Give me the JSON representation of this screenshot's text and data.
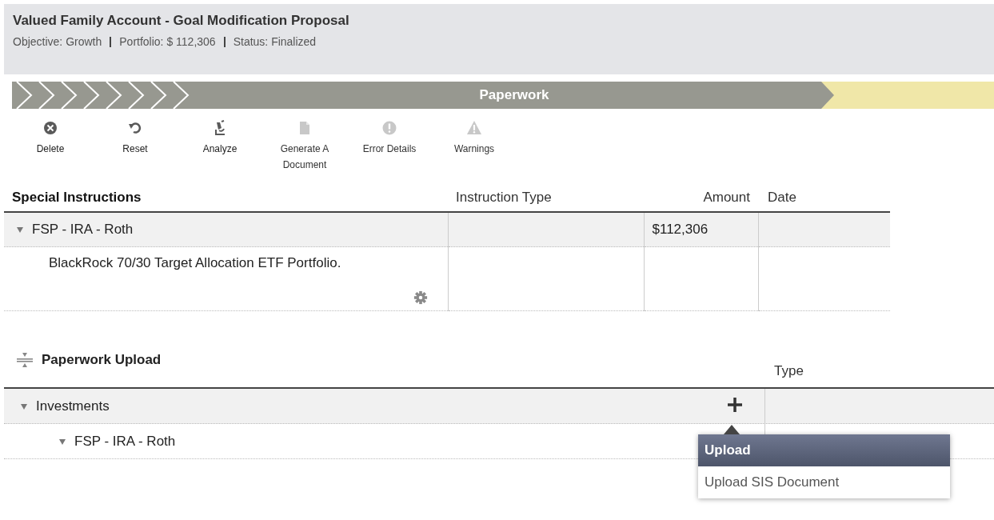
{
  "header": {
    "title": "Valued Family Account - Goal Modification Proposal",
    "facts": [
      "Objective: Growth",
      "Portfolio: $ 112,306",
      "Status: Finalized"
    ]
  },
  "progress": {
    "current": "Paperwork"
  },
  "toolbar": [
    {
      "kind": "delete",
      "label": "Delete",
      "disabled": false
    },
    {
      "kind": "reset",
      "label": "Reset",
      "disabled": false
    },
    {
      "kind": "analyze",
      "label": "Analyze",
      "disabled": false
    },
    {
      "kind": "document",
      "label": "Generate A Document",
      "disabled": true
    },
    {
      "kind": "error",
      "label": "Error Details",
      "disabled": true
    },
    {
      "kind": "warning",
      "label": "Warnings",
      "disabled": true
    }
  ],
  "special_instructions": {
    "title": "Special Instructions",
    "columns": [
      "Instruction Type",
      "Amount",
      "Date"
    ],
    "rows": [
      {
        "label": "FSP - IRA - Roth",
        "expanded": true,
        "amount": "$112,306",
        "children": [
          {
            "label": "BlackRock 70/30 Target Allocation ETF Portfolio."
          }
        ]
      }
    ]
  },
  "paperwork_upload": {
    "title": "Paperwork Upload",
    "columns": [
      "Type"
    ],
    "tree": [
      {
        "label": "Investments",
        "expanded": true,
        "children": [
          {
            "label": "FSP - IRA - Roth",
            "expanded": true
          }
        ]
      }
    ],
    "menu": {
      "title": "Upload",
      "items": [
        "Upload SIS Document"
      ]
    }
  }
}
